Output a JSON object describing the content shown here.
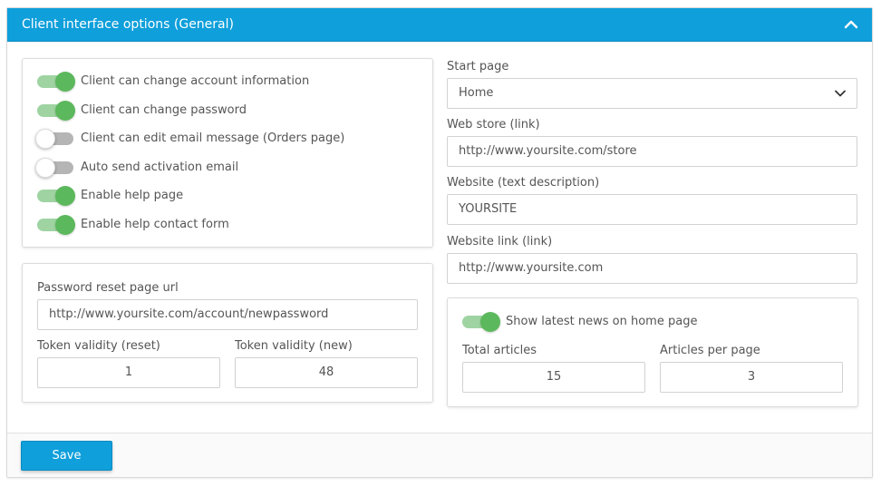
{
  "panel": {
    "title": "Client interface options (General)"
  },
  "toggles": [
    {
      "label": "Client can change account information",
      "on": true
    },
    {
      "label": "Client can change password",
      "on": true
    },
    {
      "label": "Client can edit email message (Orders page)",
      "on": false
    },
    {
      "label": "Auto send activation email",
      "on": false
    },
    {
      "label": "Enable help page",
      "on": true
    },
    {
      "label": "Enable help contact form",
      "on": true
    }
  ],
  "password": {
    "url_label": "Password reset page url",
    "url_value": "http://www.yoursite.com/account/newpassword",
    "token_reset_label": "Token validity (reset)",
    "token_reset_value": "1",
    "token_new_label": "Token validity (new)",
    "token_new_value": "48"
  },
  "right": {
    "start_page_label": "Start page",
    "start_page_value": "Home",
    "webstore_label": "Web store (link)",
    "webstore_value": "http://www.yoursite.com/store",
    "website_desc_label": "Website (text description)",
    "website_desc_value": "YOURSITE",
    "website_link_label": "Website link (link)",
    "website_link_value": "http://www.yoursite.com"
  },
  "news": {
    "toggle_label": "Show latest news on home page",
    "toggle_on": true,
    "total_label": "Total articles",
    "total_value": "15",
    "per_page_label": "Articles per page",
    "per_page_value": "3"
  },
  "footer": {
    "save_label": "Save"
  },
  "icons": {
    "collapse": "chevron-up-icon",
    "select": "chevron-down-icon"
  },
  "colors": {
    "accent": "#0f9fdb",
    "toggle_on": "#5cb85c"
  }
}
